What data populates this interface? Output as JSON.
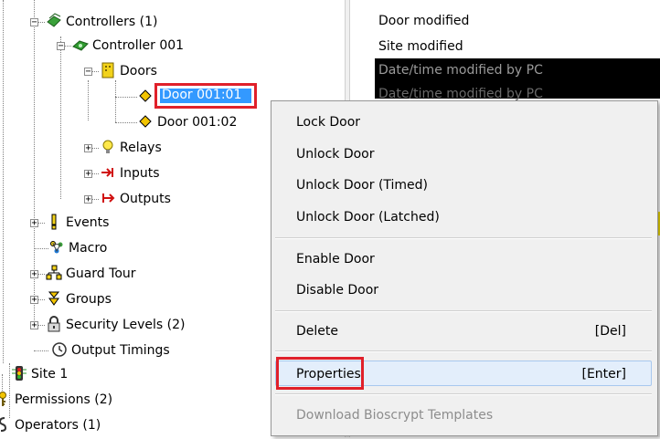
{
  "tree": {
    "nodes": [
      {
        "label": "Controllers (1)"
      },
      {
        "label": "Controller 001"
      },
      {
        "label": "Doors"
      },
      {
        "label": "Door 001:01"
      },
      {
        "label": "Door 001:02"
      },
      {
        "label": "Relays"
      },
      {
        "label": "Inputs"
      },
      {
        "label": "Outputs"
      },
      {
        "label": "Events"
      },
      {
        "label": "Macro"
      },
      {
        "label": "Guard Tour"
      },
      {
        "label": "Groups"
      },
      {
        "label": "Security Levels (2)"
      },
      {
        "label": "Output Timings"
      },
      {
        "label": "Site 1"
      },
      {
        "label": "Permissions (2)"
      },
      {
        "label": "Operators (1)"
      }
    ]
  },
  "events": [
    {
      "text": "Door modified"
    },
    {
      "text": "Site modified"
    },
    {
      "text": "Date/time modified by PC"
    },
    {
      "text": "Date/time modified by PC"
    }
  ],
  "context_menu": {
    "items": [
      {
        "label": "Lock Door",
        "shortcut": ""
      },
      {
        "label": "Unlock Door",
        "shortcut": ""
      },
      {
        "label": "Unlock Door (Timed)",
        "shortcut": ""
      },
      {
        "label": "Unlock Door (Latched)",
        "shortcut": ""
      },
      {
        "label": "Enable Door",
        "shortcut": ""
      },
      {
        "label": "Disable Door",
        "shortcut": ""
      },
      {
        "label": "Delete",
        "shortcut": "[Del]"
      },
      {
        "label": "Properties",
        "shortcut": "[Enter]"
      },
      {
        "label": "Download Bioscrypt Templates",
        "shortcut": ""
      }
    ]
  },
  "colors": {
    "selection": "#3399ff",
    "highlight_box": "#e0202a",
    "menu_bg": "#f0f0f0",
    "menu_hover": "#e3eefb",
    "disabled_text": "#8d8d8d"
  },
  "icons": {
    "controllers": "controllers-icon",
    "controller": "controller-icon",
    "doors": "doors-icon",
    "door": "door-icon",
    "relays": "relay-bulb-icon",
    "inputs": "input-icon",
    "outputs": "output-icon",
    "events": "events-icon",
    "macro": "macro-icon",
    "guard_tour": "guard-tour-icon",
    "groups": "groups-icon",
    "security_levels": "security-lock-icon",
    "output_timings": "clock-icon",
    "site": "traffic-light-icon",
    "permissions": "key-icon",
    "operators": "operators-icon"
  }
}
